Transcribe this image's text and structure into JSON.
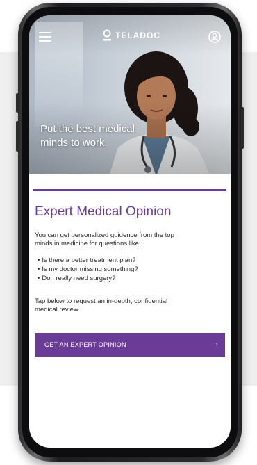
{
  "header": {
    "logo_text": "TELADOC",
    "menu_icon": "hamburger-menu-icon",
    "account_icon": "user-account-icon"
  },
  "hero": {
    "tagline_line1": "Put the best medical",
    "tagline_line2": "minds to work."
  },
  "card": {
    "title": "Expert Medical Opinion",
    "intro_line1": "You can get personalized guidence from the top",
    "intro_line2": "minds in medicine for questions like:",
    "bullets": [
      "Is there a better treatment plan?",
      "Is my doctor missing something?",
      "Do I really need surgery?"
    ],
    "outro_line1": "Tap below to request an in-depth, confidential",
    "outro_line2": "medical review.",
    "cta_label": "GET AN EXPERT OPINION",
    "cta_arrow": "›"
  },
  "colors": {
    "brand_purple": "#6a3c98",
    "text": "#2b2b2b",
    "backdrop": "#efeff0"
  }
}
